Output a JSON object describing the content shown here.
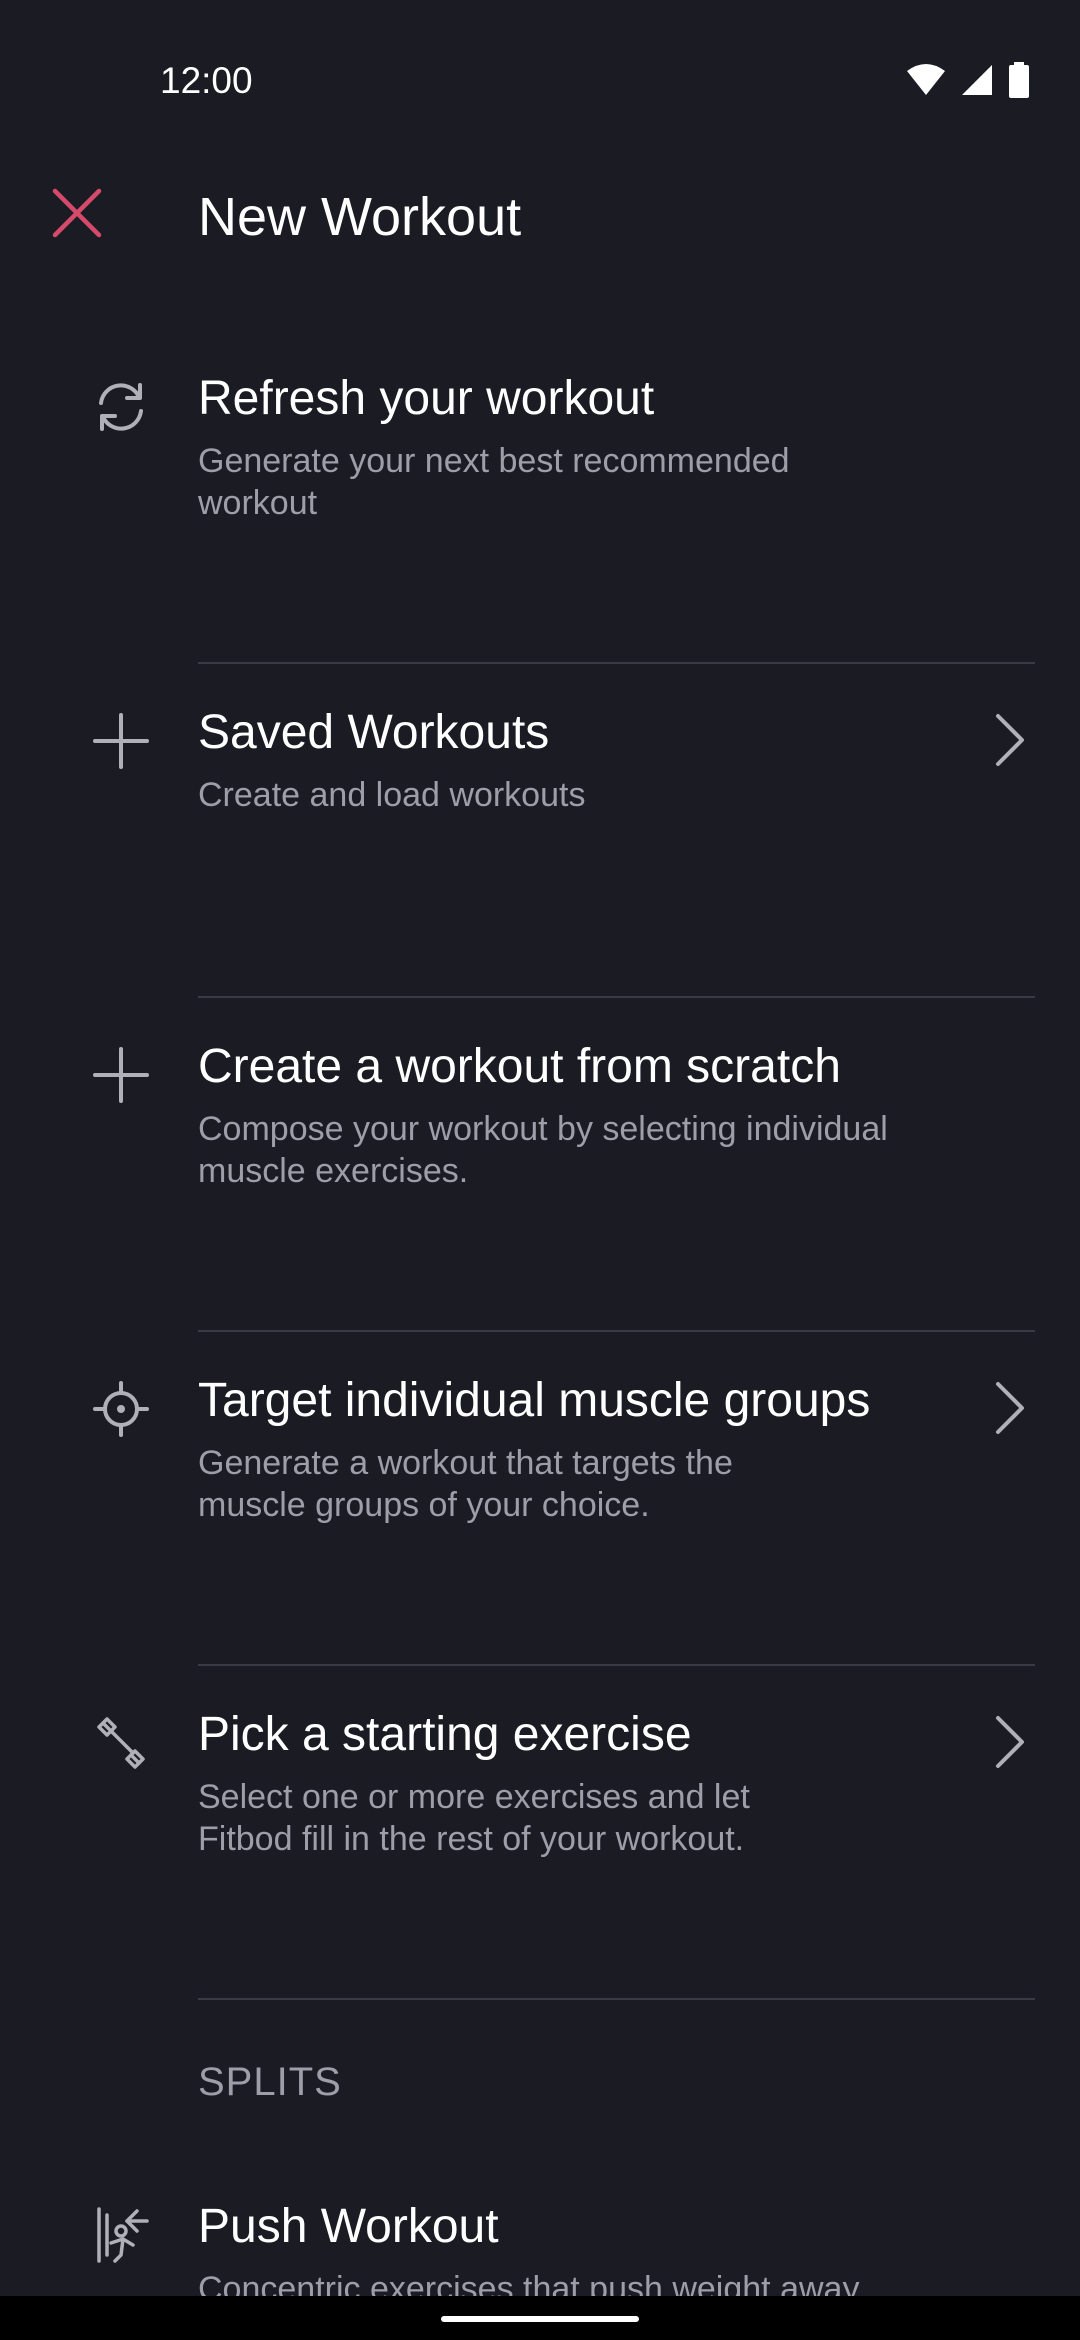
{
  "status_bar": {
    "time": "12:00"
  },
  "header": {
    "title": "New Workout",
    "accent_color": "#d64a6b"
  },
  "menu": [
    {
      "title": "Refresh your workout",
      "subtitle": "Generate your next best recommended workout",
      "icon": "refresh-icon",
      "has_chevron": false
    },
    {
      "title": "Saved Workouts",
      "subtitle": "Create and load workouts",
      "icon": "plus-icon",
      "has_chevron": true
    },
    {
      "title": "Create a workout from scratch",
      "subtitle": "Compose your workout by selecting individual muscle exercises.",
      "icon": "plus-icon",
      "has_chevron": false
    },
    {
      "title": "Target individual muscle groups",
      "subtitle": "Generate a workout that targets the muscle groups of your choice.",
      "icon": "crosshair-icon",
      "has_chevron": true
    },
    {
      "title": "Pick a starting exercise",
      "subtitle": "Select one or more exercises and let Fitbod fill in the rest of your workout.",
      "icon": "dumbbell-icon",
      "has_chevron": true
    }
  ],
  "splits": {
    "header": "SPLITS",
    "items": [
      {
        "title": "Push Workout",
        "subtitle": "Concentric exercises that push weight away",
        "icon": "push-icon"
      }
    ]
  }
}
